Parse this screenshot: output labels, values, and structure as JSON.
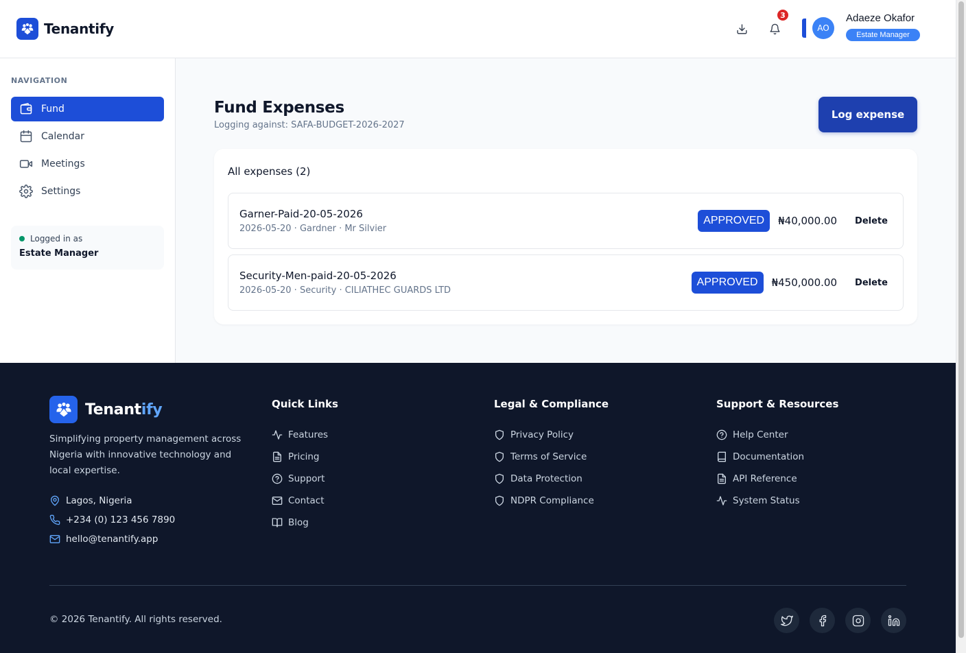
{
  "header": {
    "brand": "Tenantify",
    "notification_count": "3",
    "user": {
      "initials": "AO",
      "name": "Adaeze Okafor",
      "role": "Estate Manager"
    }
  },
  "sidebar": {
    "heading": "NAVIGATION",
    "items": [
      {
        "label": "Fund",
        "icon": "wallet-icon",
        "active": true
      },
      {
        "label": "Calendar",
        "icon": "calendar-icon",
        "active": false
      },
      {
        "label": "Meetings",
        "icon": "video-icon",
        "active": false
      },
      {
        "label": "Settings",
        "icon": "gear-icon",
        "active": false
      }
    ],
    "login": {
      "label": "Logged in as",
      "role": "Estate Manager"
    }
  },
  "main": {
    "title": "Fund Expenses",
    "subtitle": "Logging against: SAFA-BUDGET-2026-2027",
    "log_button": "Log expense",
    "card_title": "All expenses (2)",
    "expenses": [
      {
        "title": "Garner-Paid-20-05-2026",
        "meta": "2026-05-20 · Gardner · Mr Silvier",
        "status": "APPROVED",
        "amount": "₦40,000.00",
        "delete_label": "Delete"
      },
      {
        "title": "Security-Men-paid-20-05-2026",
        "meta": "2026-05-20 · Security · CILIATHEC GUARDS LTD",
        "status": "APPROVED",
        "amount": "₦450,000.00",
        "delete_label": "Delete"
      }
    ]
  },
  "footer": {
    "brand_main": "Tenant",
    "brand_accent": "ify",
    "description": "Simplifying property management across Nigeria with innovative technology and local expertise.",
    "contact": {
      "location": "Lagos, Nigeria",
      "phone": "+234 (0) 123 456 7890",
      "email": "hello@tenantify.app"
    },
    "columns": [
      {
        "title": "Quick Links",
        "links": [
          "Features",
          "Pricing",
          "Support",
          "Contact",
          "Blog"
        ]
      },
      {
        "title": "Legal & Compliance",
        "links": [
          "Privacy Policy",
          "Terms of Service",
          "Data Protection",
          "NDPR Compliance"
        ]
      },
      {
        "title": "Support & Resources",
        "links": [
          "Help Center",
          "Documentation",
          "API Reference",
          "System Status"
        ]
      }
    ],
    "copyright": "© 2026 Tenantify. All rights reserved.",
    "social": [
      "twitter-icon",
      "facebook-icon",
      "instagram-icon",
      "linkedin-icon"
    ]
  },
  "colors": {
    "primary": "#1d4ed8",
    "footer_bg": "#0f172a",
    "accent": "#60a5fa",
    "badge": "#dc2626",
    "online": "#059669"
  }
}
